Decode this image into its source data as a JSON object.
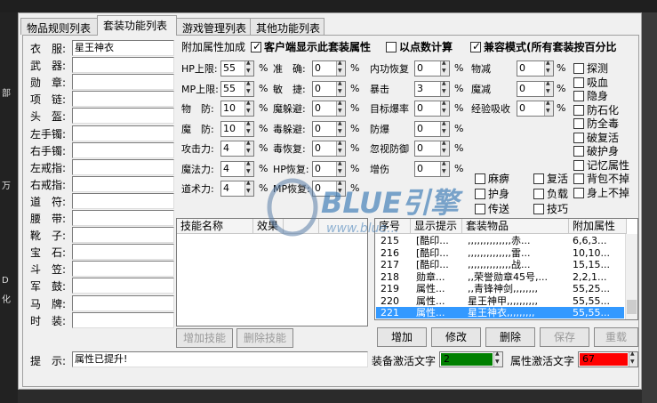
{
  "tabs": [
    "物品规则列表",
    "套装功能列表",
    "游戏管理列表",
    "其他功能列表"
  ],
  "equipment_labels": [
    "衣　服:",
    "武　器:",
    "勋　章:",
    "项　链:",
    "头　盔:",
    "左手镯:",
    "右手镯:",
    "左戒指:",
    "右戒指:",
    "道　符:",
    "腰　带:",
    "靴　子:",
    "宝　石:",
    "斗　笠:",
    "军　鼓:",
    "马　牌:",
    "时　装:"
  ],
  "equipment_values": [
    "星王神衣",
    "",
    "",
    "",
    "",
    "",
    "",
    "",
    "",
    "",
    "",
    "",
    "",
    "",
    "",
    "",
    ""
  ],
  "hint_label": "提　示:",
  "hint_value": "属性已提升!",
  "attr": {
    "prefix": "附加属性加成",
    "client_show": "客户端显示此套装属性",
    "point_calc": "以点数计算",
    "compat_mode": "兼容模式(所有套装按百分比"
  },
  "col1": [
    {
      "label": "HP上限:",
      "value": "55"
    },
    {
      "label": "MP上限:",
      "value": "55"
    },
    {
      "label": "物　防:",
      "value": "10"
    },
    {
      "label": "魔　防:",
      "value": "10"
    },
    {
      "label": "攻击力:",
      "value": "4"
    },
    {
      "label": "魔法力:",
      "value": "4"
    },
    {
      "label": "道术力:",
      "value": "4"
    }
  ],
  "col2": [
    {
      "label": "准　确:",
      "value": "0"
    },
    {
      "label": "敏　捷:",
      "value": "0"
    },
    {
      "label": "魔躲避:",
      "value": "0"
    },
    {
      "label": "毒躲避:",
      "value": "0"
    },
    {
      "label": "毒恢复:",
      "value": "0"
    },
    {
      "label": "HP恢复:",
      "value": "0"
    },
    {
      "label": "MP恢复:",
      "value": "0"
    }
  ],
  "col3": [
    {
      "label": "内功恢复",
      "value": "0"
    },
    {
      "label": "暴击",
      "value": "3"
    },
    {
      "label": "目标爆率",
      "value": "0"
    },
    {
      "label": "防爆",
      "value": "0"
    },
    {
      "label": "忽视防御",
      "value": "0"
    },
    {
      "label": "增伤",
      "value": "0"
    }
  ],
  "col4": [
    {
      "label": "物减",
      "value": "0"
    },
    {
      "label": "魔减",
      "value": "0"
    },
    {
      "label": "经验吸收",
      "value": "0"
    }
  ],
  "pct": "%",
  "right_checks": [
    "探测",
    "吸血",
    "隐身",
    "防石化",
    "防全毒",
    "破复活",
    "破护身",
    "记忆属性",
    "背包不掉",
    "身上不掉"
  ],
  "mid_checks": [
    [
      "麻痹",
      "复活"
    ],
    [
      "护身",
      "负载"
    ],
    [
      "传送",
      "技巧"
    ]
  ],
  "skill_headers": [
    "技能名称",
    "效果",
    "",
    ""
  ],
  "skill_buttons": {
    "add": "增加技能",
    "delete": "删除技能"
  },
  "suit_headers": [
    "序号",
    "显示提示",
    "套装物品",
    "附加属性"
  ],
  "suit_rows": [
    {
      "id": "215",
      "tip": "[酷印...",
      "items": ",,,,,,,,,,,,,,赤...",
      "attr": "6,6,3..."
    },
    {
      "id": "216",
      "tip": "[酷印...",
      "items": ",,,,,,,,,,,,,,雷...",
      "attr": "10,10..."
    },
    {
      "id": "217",
      "tip": "[酷印...",
      "items": ",,,,,,,,,,,,,,战...",
      "attr": "15,15..."
    },
    {
      "id": "218",
      "tip": "勋章...",
      "items": ",,荣誉勋章45号,...",
      "attr": "2,2,1..."
    },
    {
      "id": "219",
      "tip": "属性...",
      "items": ",,青锋神剑,,,,,,,,",
      "attr": "55,25..."
    },
    {
      "id": "220",
      "tip": "属性...",
      "items": "星王神甲,,,,,,,,,,",
      "attr": "55,55..."
    },
    {
      "id": "221",
      "tip": "属性...",
      "items": "星王神衣,,,,,,,,,",
      "attr": "55,55..."
    }
  ],
  "selected_row": 6,
  "suit_buttons": {
    "add": "增加",
    "edit": "修改",
    "delete": "删除",
    "save": "保存",
    "reload": "重载"
  },
  "equip_activate_label": "装备激活文字",
  "equip_activate_value": "2",
  "attr_activate_label": "属性激活文字",
  "attr_activate_value": "67",
  "colors": {
    "equip_green": "#008000",
    "attr_red": "#ff0000",
    "selection": "#3399ff"
  },
  "watermark": {
    "title": "BLUE引擎",
    "url": "www.blue..."
  },
  "side_glyphs": [
    "部",
    "万",
    "D",
    "化"
  ]
}
